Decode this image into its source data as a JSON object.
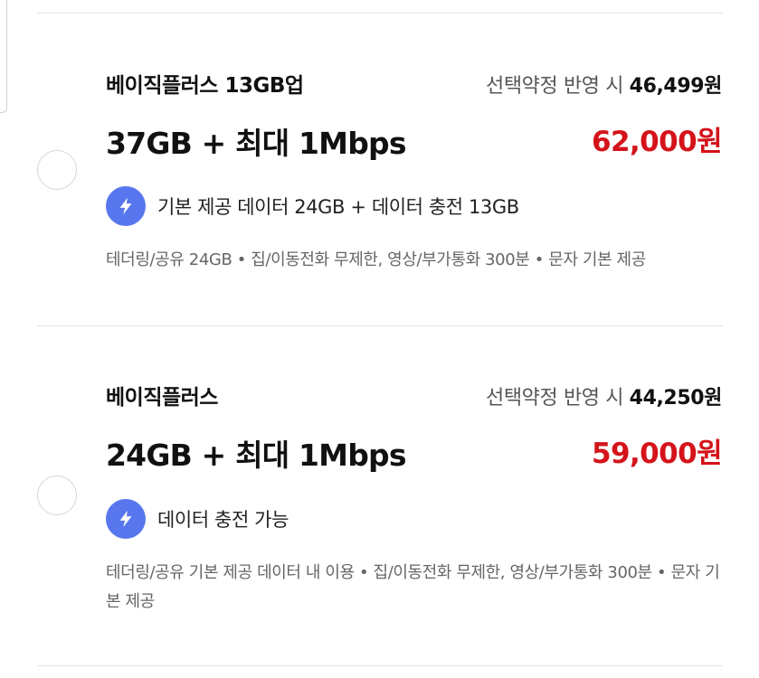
{
  "plans": [
    {
      "name": "베이직플러스 13GB업",
      "discount_label": "선택약정 반영 시",
      "discount_price": "46,499원",
      "headline": "37GB + 최대 1Mbps",
      "price": "62,000원",
      "benefit": "기본 제공 데이터 24GB + 데이터 충전 13GB",
      "detail": "테더링/공유 24GB • 집/이동전화 무제한, 영상/부가통화 300분 • 문자 기본 제공"
    },
    {
      "name": "베이직플러스",
      "discount_label": "선택약정 반영 시",
      "discount_price": "44,250원",
      "headline": "24GB + 최대 1Mbps",
      "price": "59,000원",
      "benefit": "데이터 충전 가능",
      "detail": "테더링/공유 기본 제공 데이터 내 이용 • 집/이동전화 무제한, 영상/부가통화 300분 • 문자 기본 제공"
    }
  ],
  "colors": {
    "price": "#d4131a",
    "bolt_badge": "#5877ee",
    "divider": "#e4e4e4"
  },
  "icons": {
    "benefit": "lightning-bolt-icon",
    "select": "radio-button"
  }
}
